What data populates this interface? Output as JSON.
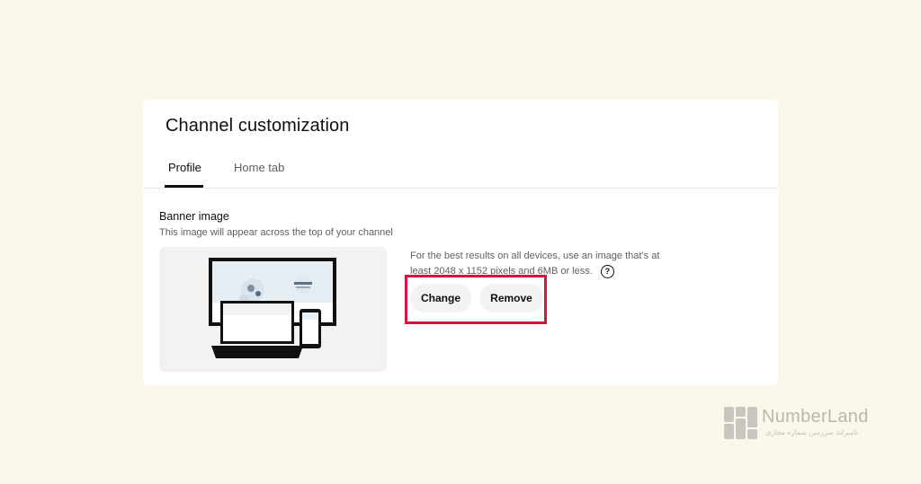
{
  "page": {
    "title": "Channel customization",
    "tabs": [
      {
        "label": "Profile",
        "active": true
      },
      {
        "label": "Home tab",
        "active": false
      }
    ]
  },
  "banner": {
    "title": "Banner image",
    "description": "This image will appear across the top of your channel",
    "info_text": "For the best results on all devices, use an image that’s at least 2048 x 1152 pixels and 6MB or less.",
    "help_icon": "?",
    "change_label": "Change",
    "remove_label": "Remove"
  },
  "watermark": {
    "brand": "NumberLand",
    "tagline": "نامبرلند سرزمین شماره مجازی"
  },
  "colors": {
    "background": "#fbf7ea",
    "highlight": "#d7143f",
    "button_bg": "#f2f2f2"
  }
}
